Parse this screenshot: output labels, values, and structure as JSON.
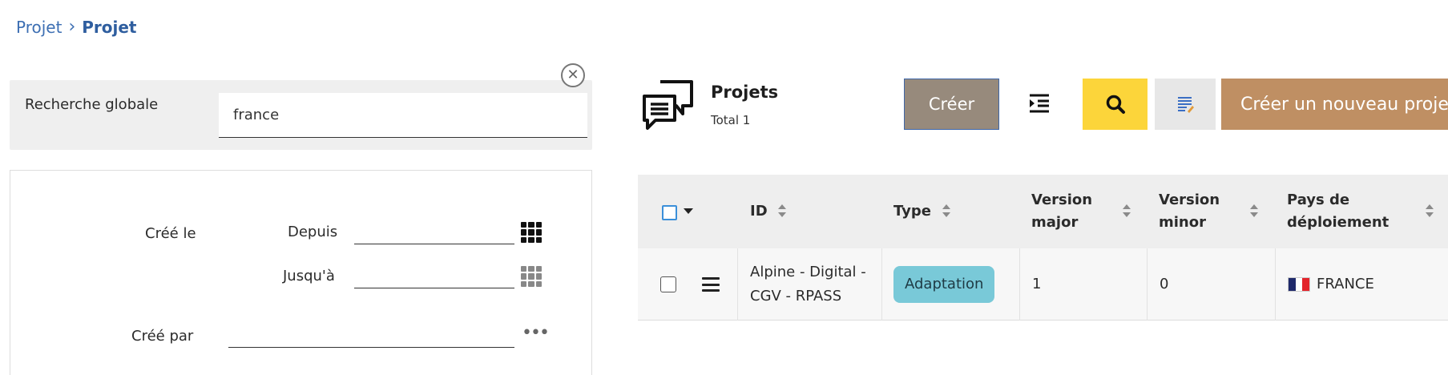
{
  "breadcrumb": {
    "parent": "Projet",
    "current": "Projet",
    "separator": "›"
  },
  "search": {
    "label": "Recherche globale",
    "value": "france"
  },
  "filters": {
    "created_on_label": "Créé le",
    "since_label": "Depuis",
    "until_label": "Jusqu'à",
    "created_by_label": "Créé par"
  },
  "header": {
    "title": "Projets",
    "total": "Total 1"
  },
  "toolbar": {
    "create_label": "Créer",
    "new_project_label": "Créer un nouveau projet"
  },
  "table": {
    "columns": {
      "id": "ID",
      "type": "Type",
      "version_major": "Version major",
      "version_minor": "Version minor",
      "country": "Pays de déploiement"
    },
    "rows": [
      {
        "id": "Alpine - Digital - CGV - RPASS",
        "type": "Adaptation",
        "version_major": "1",
        "version_minor": "0",
        "country": "FRANCE"
      }
    ]
  },
  "colors": {
    "link": "#3d6fb3",
    "create_button": "#978a7c",
    "search_button": "#fcd53a",
    "new_project_button": "#bf8f63",
    "badge": "#79c9d8",
    "checkbox_accent": "#3b8fd9"
  },
  "icons": [
    "close-icon",
    "calendar-grid-icon",
    "more-dots-icon",
    "chat-icon",
    "indent-icon",
    "search-icon",
    "list-edit-icon",
    "sort-icon",
    "menu-icon",
    "france-flag-icon"
  ]
}
